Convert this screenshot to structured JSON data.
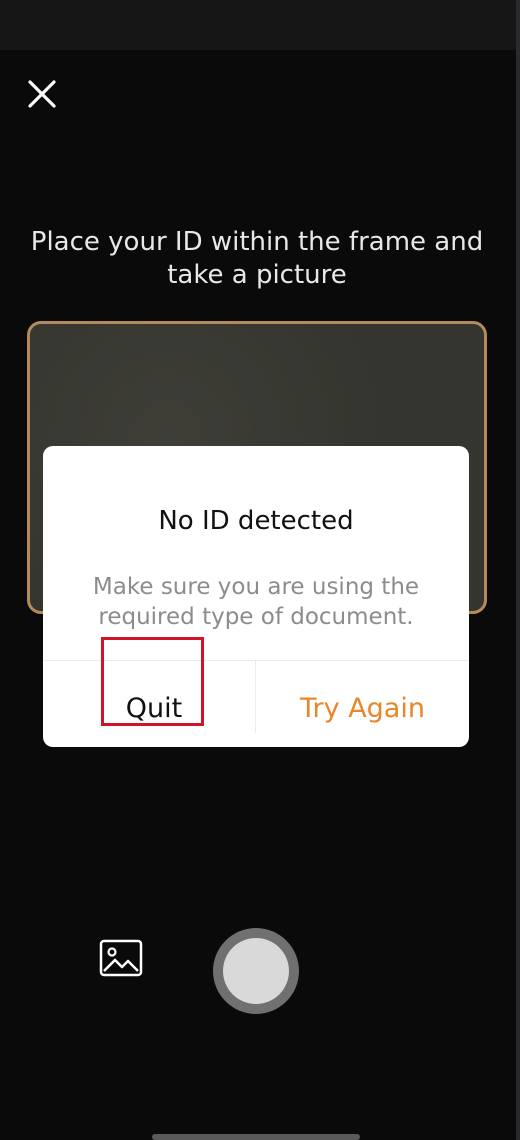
{
  "capture": {
    "instruction": "Place your ID within the frame and\ntake a picture"
  },
  "dialog": {
    "title": "No ID detected",
    "message": "Make sure you are using the\nrequired type of document.",
    "quit_label": "Quit",
    "retry_label": "Try Again"
  },
  "icons": {
    "close": "close-icon",
    "gallery": "gallery-icon",
    "shutter": "shutter-icon"
  },
  "colors": {
    "accent": "#e8862a",
    "frame_border": "#b38a5c",
    "highlight": "#d0142b"
  }
}
